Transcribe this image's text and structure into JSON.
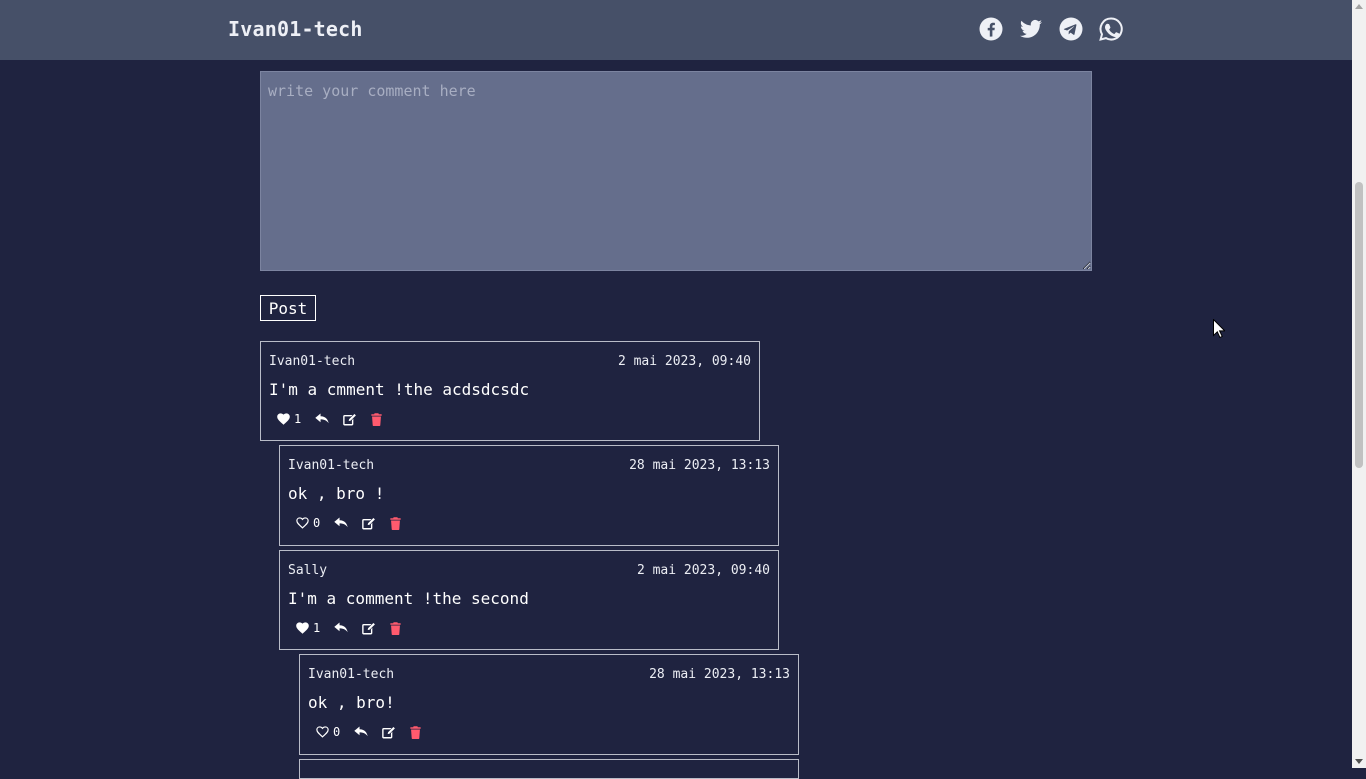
{
  "header": {
    "brand": "Ivan01-tech",
    "social_icons": [
      "facebook-icon",
      "twitter-icon",
      "telegram-icon",
      "whatsapp-icon"
    ]
  },
  "composer": {
    "placeholder": "write your comment here",
    "value": "",
    "post_label": "Post"
  },
  "comments": [
    {
      "author": "Ivan01-tech",
      "date": "2 mai 2023, 09:40",
      "text": "I'm a cmment !the acdsdcsdc",
      "likes": "1",
      "liked": true
    },
    {
      "author": "Ivan01-tech",
      "date": "28 mai 2023, 13:13",
      "text": "ok , bro !",
      "likes": "0",
      "liked": false
    },
    {
      "author": "Sally",
      "date": "2 mai 2023, 09:40",
      "text": "I'm a comment !the second",
      "likes": "1",
      "liked": true
    },
    {
      "author": "Ivan01-tech",
      "date": "28 mai 2023, 13:13",
      "text": "ok , bro!",
      "likes": "0",
      "liked": false
    }
  ],
  "colors": {
    "background": "#1f2340",
    "header": "#465068",
    "textarea": "#656e8c",
    "delete": "#ff5a6e"
  }
}
